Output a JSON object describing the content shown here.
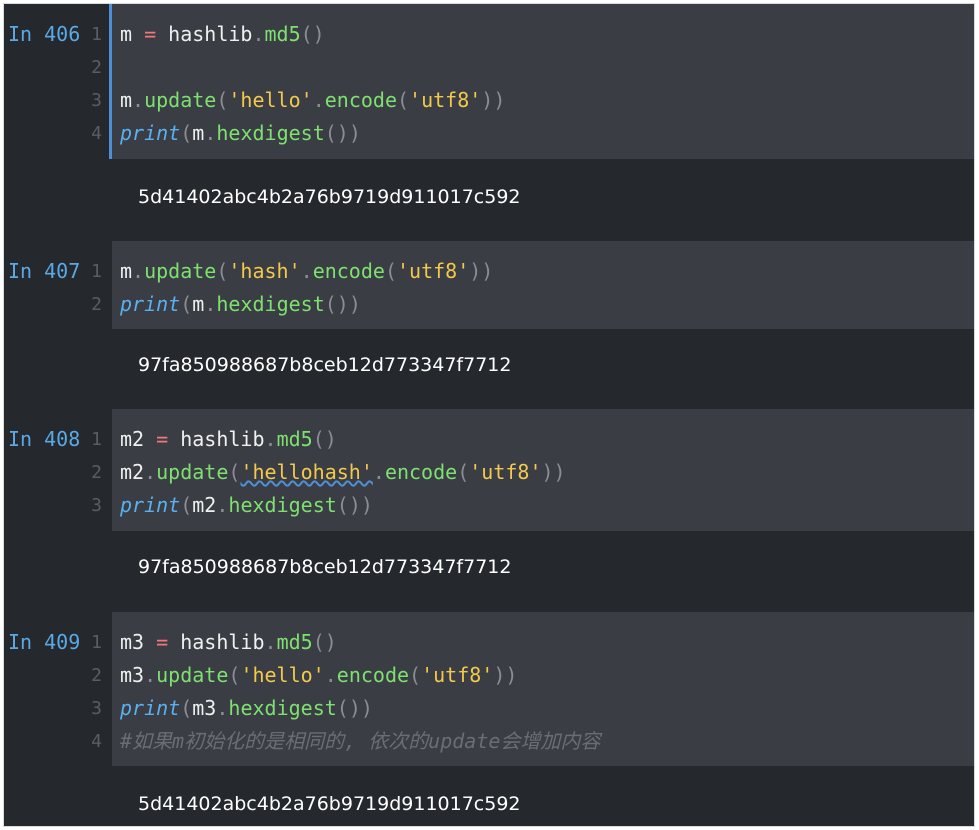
{
  "cells": [
    {
      "prompt": "In 406",
      "lines": [
        {
          "num": "1",
          "tokens": [
            {
              "t": "m",
              "c": "var"
            },
            {
              "t": " = ",
              "c": "op"
            },
            {
              "t": "hashlib",
              "c": "var"
            },
            {
              "t": ".",
              "c": "punc"
            },
            {
              "t": "md5",
              "c": "func"
            },
            {
              "t": "()",
              "c": "punc"
            }
          ]
        },
        {
          "num": "2",
          "tokens": []
        },
        {
          "num": "3",
          "tokens": [
            {
              "t": "m",
              "c": "var"
            },
            {
              "t": ".",
              "c": "punc"
            },
            {
              "t": "update",
              "c": "func"
            },
            {
              "t": "(",
              "c": "punc"
            },
            {
              "t": "'hello'",
              "c": "str"
            },
            {
              "t": ".",
              "c": "punc"
            },
            {
              "t": "encode",
              "c": "func"
            },
            {
              "t": "(",
              "c": "punc"
            },
            {
              "t": "'utf8'",
              "c": "str"
            },
            {
              "t": "))",
              "c": "punc"
            }
          ]
        },
        {
          "num": "4",
          "tokens": [
            {
              "t": "print",
              "c": "kw"
            },
            {
              "t": "(",
              "c": "punc"
            },
            {
              "t": "m",
              "c": "var"
            },
            {
              "t": ".",
              "c": "punc"
            },
            {
              "t": "hexdigest",
              "c": "func"
            },
            {
              "t": "())",
              "c": "punc"
            }
          ]
        }
      ],
      "output": "5d41402abc4b2a76b9719d911017c592"
    },
    {
      "prompt": "In 407",
      "lines": [
        {
          "num": "1",
          "tokens": [
            {
              "t": "m",
              "c": "var"
            },
            {
              "t": ".",
              "c": "punc"
            },
            {
              "t": "update",
              "c": "func"
            },
            {
              "t": "(",
              "c": "punc"
            },
            {
              "t": "'hash'",
              "c": "str"
            },
            {
              "t": ".",
              "c": "punc"
            },
            {
              "t": "encode",
              "c": "func"
            },
            {
              "t": "(",
              "c": "punc"
            },
            {
              "t": "'utf8'",
              "c": "str"
            },
            {
              "t": "))",
              "c": "punc"
            }
          ]
        },
        {
          "num": "2",
          "tokens": [
            {
              "t": "print",
              "c": "kw"
            },
            {
              "t": "(",
              "c": "punc"
            },
            {
              "t": "m",
              "c": "var"
            },
            {
              "t": ".",
              "c": "punc"
            },
            {
              "t": "hexdigest",
              "c": "func"
            },
            {
              "t": "())",
              "c": "punc"
            }
          ]
        }
      ],
      "output": "97fa850988687b8ceb12d773347f7712"
    },
    {
      "prompt": "In 408",
      "lines": [
        {
          "num": "1",
          "tokens": [
            {
              "t": "m2",
              "c": "var"
            },
            {
              "t": " = ",
              "c": "op"
            },
            {
              "t": "hashlib",
              "c": "var"
            },
            {
              "t": ".",
              "c": "punc"
            },
            {
              "t": "md5",
              "c": "func"
            },
            {
              "t": "()",
              "c": "punc"
            }
          ]
        },
        {
          "num": "2",
          "tokens": [
            {
              "t": "m2",
              "c": "var"
            },
            {
              "t": ".",
              "c": "punc"
            },
            {
              "t": "update",
              "c": "func"
            },
            {
              "t": "(",
              "c": "punc"
            },
            {
              "t": "'hellohash'",
              "c": "str",
              "u": true
            },
            {
              "t": ".",
              "c": "punc"
            },
            {
              "t": "encode",
              "c": "func"
            },
            {
              "t": "(",
              "c": "punc"
            },
            {
              "t": "'utf8'",
              "c": "str"
            },
            {
              "t": "))",
              "c": "punc"
            }
          ]
        },
        {
          "num": "3",
          "tokens": [
            {
              "t": "print",
              "c": "kw"
            },
            {
              "t": "(",
              "c": "punc"
            },
            {
              "t": "m2",
              "c": "var"
            },
            {
              "t": ".",
              "c": "punc"
            },
            {
              "t": "hexdigest",
              "c": "func"
            },
            {
              "t": "())",
              "c": "punc"
            }
          ]
        }
      ],
      "output": "97fa850988687b8ceb12d773347f7712"
    },
    {
      "prompt": "In 409",
      "lines": [
        {
          "num": "1",
          "tokens": [
            {
              "t": "m3",
              "c": "var"
            },
            {
              "t": " = ",
              "c": "op"
            },
            {
              "t": "hashlib",
              "c": "var"
            },
            {
              "t": ".",
              "c": "punc"
            },
            {
              "t": "md5",
              "c": "func"
            },
            {
              "t": "()",
              "c": "punc"
            }
          ]
        },
        {
          "num": "2",
          "tokens": [
            {
              "t": "m3",
              "c": "var"
            },
            {
              "t": ".",
              "c": "punc"
            },
            {
              "t": "update",
              "c": "func"
            },
            {
              "t": "(",
              "c": "punc"
            },
            {
              "t": "'hello'",
              "c": "str"
            },
            {
              "t": ".",
              "c": "punc"
            },
            {
              "t": "encode",
              "c": "func"
            },
            {
              "t": "(",
              "c": "punc"
            },
            {
              "t": "'utf8'",
              "c": "str"
            },
            {
              "t": "))",
              "c": "punc"
            }
          ]
        },
        {
          "num": "3",
          "tokens": [
            {
              "t": "print",
              "c": "kw"
            },
            {
              "t": "(",
              "c": "punc"
            },
            {
              "t": "m3",
              "c": "var"
            },
            {
              "t": ".",
              "c": "punc"
            },
            {
              "t": "hexdigest",
              "c": "func"
            },
            {
              "t": "())",
              "c": "punc"
            }
          ]
        },
        {
          "num": "4",
          "tokens": [
            {
              "t": "#如果m初始化的是相同的, 依次的update会增加内容",
              "c": "cmt"
            }
          ]
        }
      ],
      "output": "5d41402abc4b2a76b9719d911017c592"
    }
  ],
  "colors": {
    "background": "#25282c",
    "code_background": "#3a3e44",
    "prompt": "#5aa9e6",
    "active_cell_bar": "#4f8fd8"
  }
}
